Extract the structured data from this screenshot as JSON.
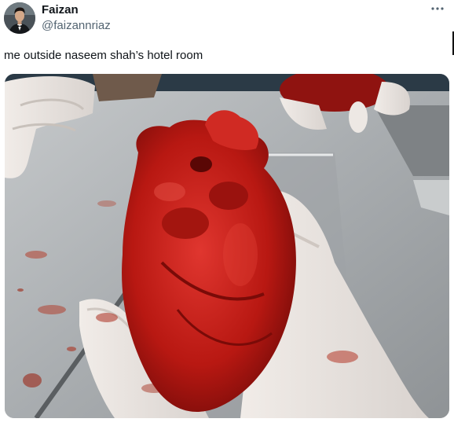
{
  "author": {
    "display_name": "Faizan",
    "handle": "@faizannriaz",
    "avatar_icon": "profile-avatar"
  },
  "post": {
    "text": "me outside naseem shah’s hotel room"
  },
  "more_menu": {
    "icon": "more-dots-icon"
  },
  "media": {
    "kind": "photo"
  },
  "colors": {
    "name_text": "#0f1419",
    "handle_text": "#536471",
    "background": "#ffffff"
  }
}
